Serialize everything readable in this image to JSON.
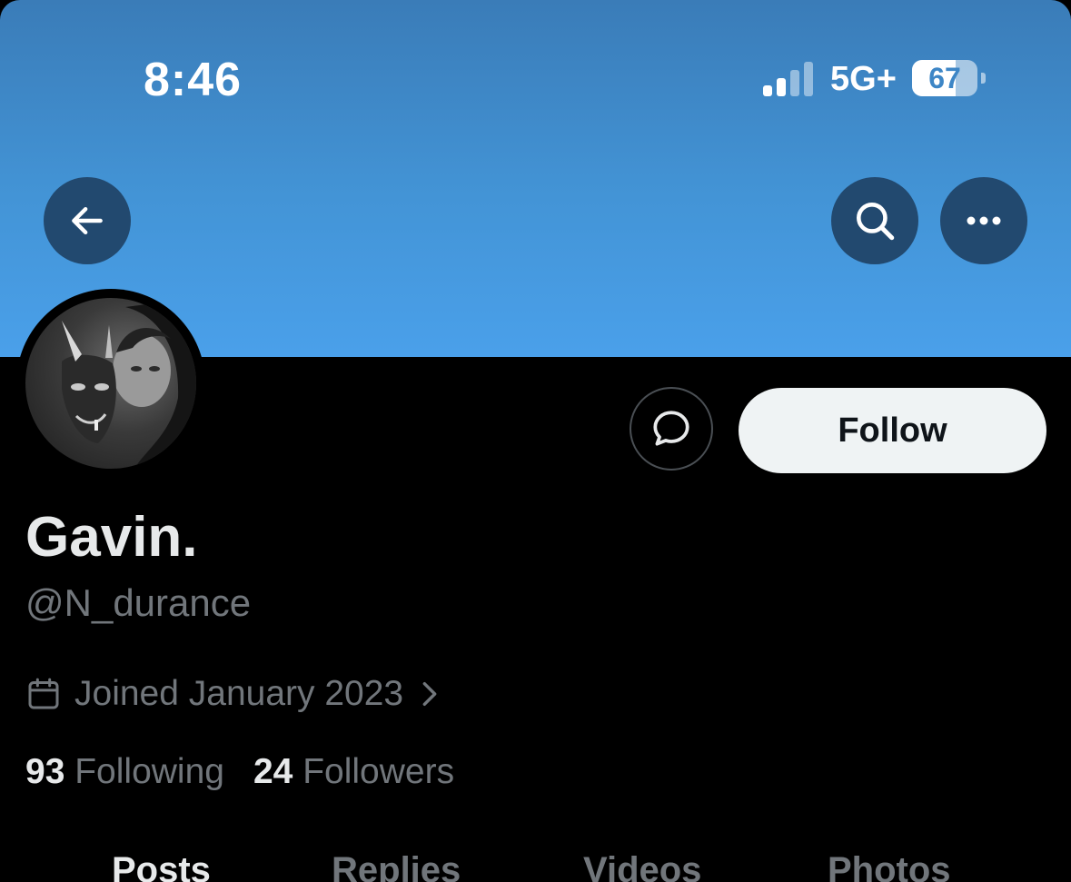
{
  "status_bar": {
    "time": "8:46",
    "network": "5G+",
    "battery_level": "67",
    "battery_fraction": 0.67,
    "signal_bars_active": 2,
    "signal_bars_total": 4
  },
  "nav": {
    "back_icon": "arrow-left-icon",
    "search_icon": "search-icon",
    "more_icon": "more-horizontal-icon"
  },
  "profile": {
    "display_name": "Gavin.",
    "handle": "@N_durance",
    "joined": "Joined January 2023",
    "following_count": "93",
    "following_label": "Following",
    "followers_count": "24",
    "followers_label": "Followers"
  },
  "actions": {
    "message_icon": "message-bubble-icon",
    "follow_label": "Follow"
  },
  "tabs": [
    {
      "label": "Posts",
      "active": true
    },
    {
      "label": "Replies",
      "active": false
    },
    {
      "label": "Videos",
      "active": false
    },
    {
      "label": "Photos",
      "active": false
    }
  ],
  "colors": {
    "banner": "#4394d6",
    "nav_button": "#22496f",
    "follow_button": "#eff3f4",
    "primary_text": "#e7e9ea",
    "secondary_text": "#71767b"
  }
}
